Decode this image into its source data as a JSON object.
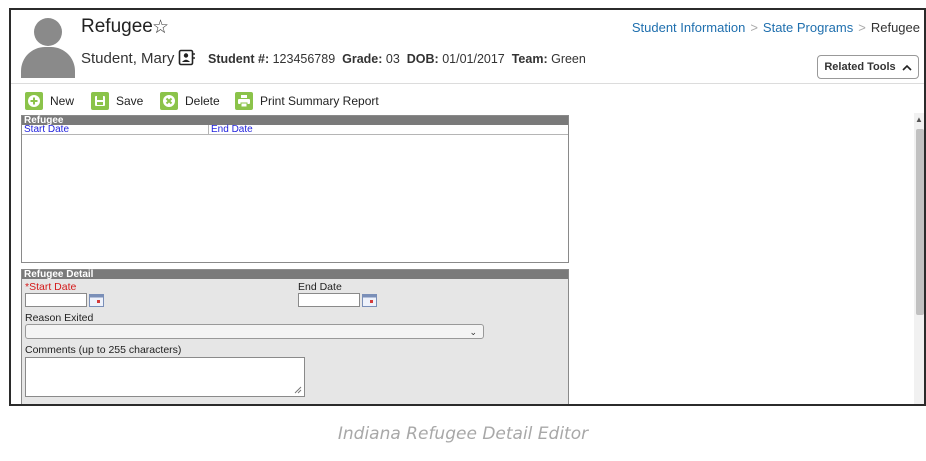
{
  "header": {
    "title": "Refugee",
    "student_name": "Student, Mary",
    "student_num_label": "Student #:",
    "student_num": "123456789",
    "grade_label": "Grade:",
    "grade": "03",
    "dob_label": "DOB:",
    "dob": "01/01/2017",
    "team_label": "Team:",
    "team": "Green"
  },
  "breadcrumb": {
    "items": [
      "Student Information",
      "State Programs"
    ],
    "current": "Refugee"
  },
  "related_tools": {
    "label": "Related Tools"
  },
  "toolbar": {
    "new_label": "New",
    "save_label": "Save",
    "delete_label": "Delete",
    "print_label": "Print Summary Report"
  },
  "list_panel": {
    "title": "Refugee",
    "columns": [
      "Start Date",
      "End Date"
    ],
    "rows": []
  },
  "detail_panel": {
    "title": "Refugee Detail",
    "start_date_label": "*Start Date",
    "start_date_value": "",
    "end_date_label": "End Date",
    "end_date_value": "",
    "reason_label": "Reason Exited",
    "reason_value": "",
    "comments_label": "Comments (up to 255 characters)",
    "comments_value": ""
  },
  "caption": "Indiana Refugee Detail Editor",
  "colors": {
    "accent_green": "#8bc34a",
    "link_blue": "#1f6fae",
    "panel_header": "#7a7a7a",
    "required_red": "#d41a1a",
    "column_header_blue": "#2222dd"
  },
  "icons": [
    "star-icon",
    "contact-card-icon",
    "chevron-up-icon",
    "plus-icon",
    "save-icon",
    "delete-icon",
    "print-icon",
    "calendar-icon",
    "chevron-down-icon"
  ]
}
